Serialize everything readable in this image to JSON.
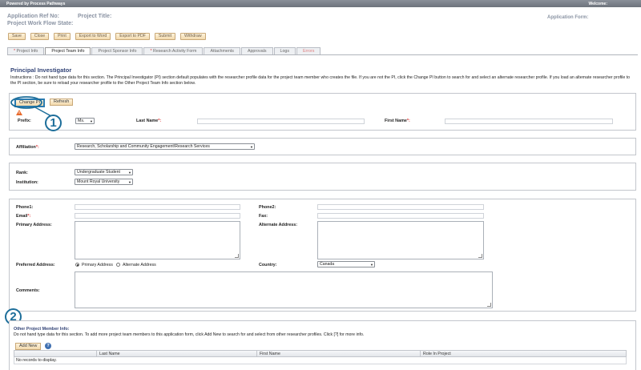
{
  "topbar": {
    "powered_by": "Powered by Process Pathways",
    "welcome": "Welcome:"
  },
  "header": {
    "app_ref_label": "Application Ref No:",
    "project_title_label": "Project Title:",
    "workflow_state_label": "Project Work Flow State:",
    "app_form_label": "Application Form:"
  },
  "toolbar": [
    "Save",
    "Close",
    "Print",
    "Export to Word",
    "Export to PDF",
    "Submit",
    "Withdraw"
  ],
  "tabs": [
    {
      "label": "Project Info",
      "required": true
    },
    {
      "label": "Project Team Info",
      "required": false
    },
    {
      "label": "Project Sponsor Info",
      "required": false
    },
    {
      "label": "Research Activity Form",
      "required": true
    },
    {
      "label": "Attachments",
      "required": false
    },
    {
      "label": "Approvals",
      "required": false
    },
    {
      "label": "Logs",
      "required": false
    },
    {
      "label": "Errors",
      "required": false
    }
  ],
  "pi": {
    "title": "Principal Investigator",
    "instructions": "Instructions : Do not hand type data for this section. The Principal Investigator (PI) section default populates with the researcher profile data for the project team member who creates the file. If you are not the PI, click the Change PI button to search for and select an alternate researcher profile. If you load an alternate researcher profile to the PI section, be sure to reload your researcher profile to the Other Project Team Info section below.",
    "change_pi": "Change PI",
    "refresh": "Refresh",
    "prefix_label": "Prefix:",
    "prefix_value": "Ms.",
    "last_name_label": "Last Name",
    "first_name_label": "First Name",
    "req_mark": "*:",
    "affiliation_label": "Affiliation",
    "affiliation_value": "Research, Scholarship and Community Engagement\\Research Services",
    "rank_label": "Rank:",
    "rank_value": "Undergraduate Student",
    "institution_label": "Institution:",
    "institution_value": "Mount Royal University",
    "phone1_label": "Phone1:",
    "phone2_label": "Phone2:",
    "email_label": "Email",
    "fax_label": "Fax:",
    "primary_address_label": "Primary Address:",
    "alternate_address_label": "Alternate Address:",
    "preferred_address_label": "Preferred Address:",
    "preferred_primary": "Primary Address",
    "preferred_alternate": "Alternate Address",
    "country_label": "Country:",
    "country_value": "Canada",
    "comments_label": "Comments:"
  },
  "other": {
    "title": "Other Project Member Info:",
    "instructions": "Do not hand type data for this section. To add more project team members to this application form, click Add New to search for and select from other researcher profiles. Click [?] for more info.",
    "add_new": "Add New",
    "help": "?",
    "columns": [
      "Last Name",
      "First Name",
      "Role In Project"
    ],
    "empty": "No records to display."
  },
  "callouts": [
    "1",
    "2"
  ],
  "colors": {
    "accent": "#1d6e9a",
    "required": "#dd3333",
    "heading": "#334477"
  }
}
